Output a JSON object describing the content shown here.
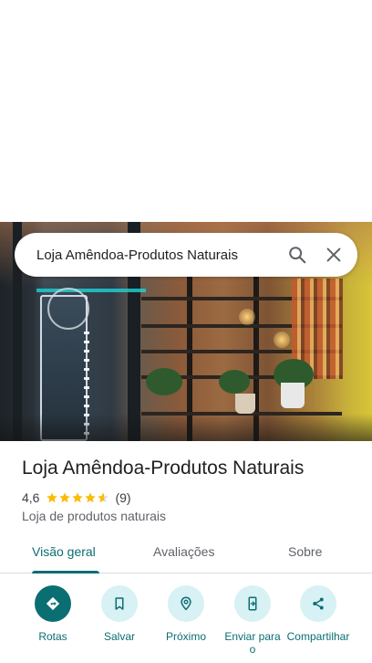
{
  "search": {
    "query": "Loja Amêndoa-Produtos Naturais",
    "icons": {
      "search": "search-icon",
      "close": "close-icon"
    }
  },
  "place": {
    "name": "Loja Amêndoa-Produtos Naturais",
    "rating": "4,6",
    "rating_value": 4.6,
    "review_count": "(9)",
    "category": "Loja de produtos naturais"
  },
  "tabs": [
    {
      "label": "Visão geral",
      "active": true
    },
    {
      "label": "Avaliações",
      "active": false
    },
    {
      "label": "Sobre",
      "active": false
    }
  ],
  "actions": [
    {
      "label": "Rotas",
      "icon": "directions-icon"
    },
    {
      "label": "Salvar",
      "icon": "bookmark-icon"
    },
    {
      "label": "Próximo",
      "icon": "nearby-icon"
    },
    {
      "label": "Enviar para o",
      "icon": "send-to-phone-icon"
    },
    {
      "label": "Compartilhar",
      "icon": "share-icon"
    }
  ],
  "colors": {
    "accent": "#0b6e72",
    "action_circle": "#d7f1f4",
    "star": "#fbbc04"
  }
}
